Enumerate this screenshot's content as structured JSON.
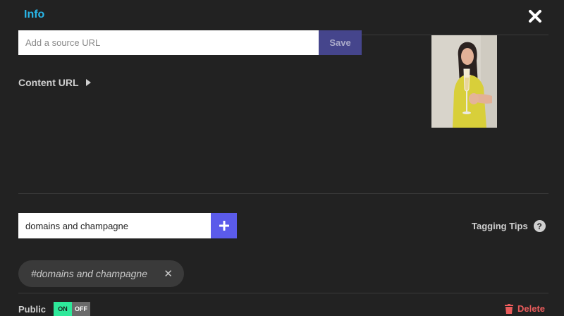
{
  "header": {
    "tab_label": "Info",
    "close_icon": "close-icon"
  },
  "source": {
    "placeholder": "Add a source URL",
    "value": "",
    "save_label": "Save"
  },
  "content_url": {
    "label": "Content URL",
    "icon": "triangle-right-icon"
  },
  "tags": {
    "input_value": "domains and champagne",
    "add_icon": "plus-icon",
    "tips_label": "Tagging Tips",
    "tips_icon": "question-icon",
    "chips": [
      {
        "label": "#domains and champagne",
        "remove_icon": "close-icon"
      }
    ]
  },
  "footer": {
    "public_label": "Public",
    "toggle_on": "ON",
    "toggle_off": "OFF",
    "toggle_state": "on",
    "delete_label": "Delete",
    "delete_icon": "trash-icon"
  },
  "colors": {
    "background": "#222222",
    "accent": "#29b6e8",
    "save_button": "#45458c",
    "add_button": "#5b5bea",
    "toggle_on": "#2ee89a",
    "delete": "#e85b5b"
  }
}
